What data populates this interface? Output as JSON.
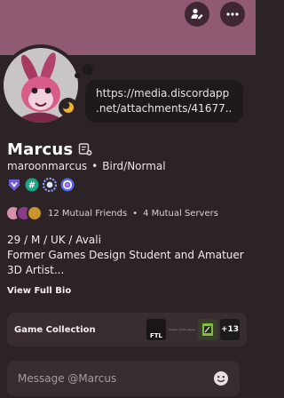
{
  "profile": {
    "display_name": "Marcus",
    "username": "maroonmarcus",
    "separator": "•",
    "pronoun_tag": "Bird/Normal",
    "custom_status": {
      "line1": "https://media.discordapp",
      "line2": ".net/attachments/41677..."
    },
    "bio": {
      "line1": "29 / M / UK / Avali",
      "line2": "Former Games Design Student and Amatuer",
      "line3": "3D Artist..."
    },
    "view_full_bio": "View Full Bio"
  },
  "top_actions": {
    "status_icon": "person-edit-icon",
    "more_icon": "more-horizontal-icon"
  },
  "badges": [
    {
      "icon": "hypesquad-badge-icon",
      "color": "#6f5bd6"
    },
    {
      "icon": "hashtag-badge-icon",
      "color": "#1aa587"
    },
    {
      "icon": "gear-badge-icon",
      "color": "#8a9ef5"
    },
    {
      "icon": "nitro-badge-icon",
      "color": "#5865f2"
    }
  ],
  "mutuals": {
    "friends": "12 Mutual Friends",
    "dot": "•",
    "servers": "4 Mutual Servers"
  },
  "game_collection": {
    "label": "Game Collection",
    "ftl_label": "FTL",
    "tiny_label": "Viewer of the Abyss",
    "more_count": "+13"
  },
  "message": {
    "placeholder": "Message @Marcus"
  },
  "colors": {
    "banner": "#8f5a72",
    "panel": "#2b2326",
    "card": "#382d31",
    "status_idle": "#f0b232"
  }
}
